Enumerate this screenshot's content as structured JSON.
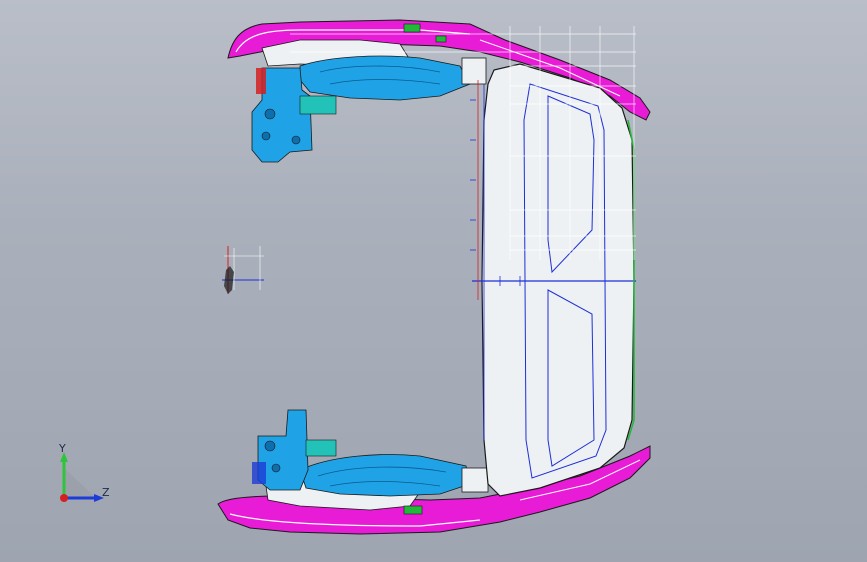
{
  "window": {
    "title": ""
  },
  "viewport": {
    "background_top": "#b9bec8",
    "background_bottom": "#9ea5b1",
    "model_colors": {
      "trim": "#e81bd6",
      "panel": "#eef1f4",
      "bracket": "#1fa3e6",
      "edge": "#1a1a1a",
      "sketch": "#1d2fd6",
      "highlight": "#ffffff",
      "accent_green": "#24b83a",
      "accent_red": "#d42020"
    }
  },
  "triad": {
    "y_label": "Y",
    "z_label": "Z",
    "y_color": "#2fc43b",
    "z_color": "#1d3bd6",
    "origin_color": "#d42020"
  }
}
